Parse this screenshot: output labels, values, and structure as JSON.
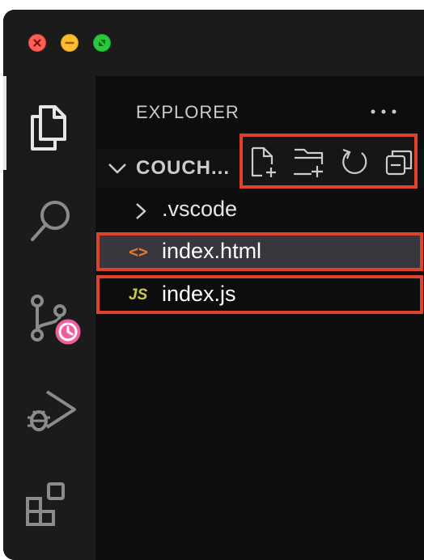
{
  "activity_bar": {
    "items": [
      {
        "name": "explorer",
        "icon": "files-icon",
        "active": true
      },
      {
        "name": "search",
        "icon": "search-icon"
      },
      {
        "name": "source-control",
        "icon": "source-control-icon",
        "badge_icon": "clock-icon",
        "badge_color": "#f25d9c"
      },
      {
        "name": "run-and-debug",
        "icon": "run-debug-icon"
      },
      {
        "name": "extensions",
        "icon": "extensions-icon"
      }
    ]
  },
  "sidebar": {
    "title": "EXPLORER",
    "more_icon": "ellipsis-icon",
    "section": {
      "title": "COUCH...",
      "actions": [
        {
          "name": "new-file",
          "icon": "new-file-icon"
        },
        {
          "name": "new-folder",
          "icon": "new-folder-icon"
        },
        {
          "name": "refresh",
          "icon": "refresh-icon"
        },
        {
          "name": "collapse-all",
          "icon": "collapse-all-icon"
        }
      ]
    },
    "tree": [
      {
        "type": "folder",
        "label": ".vscode"
      },
      {
        "type": "file",
        "label": "index.html",
        "icon_text": "<>",
        "selected": true
      },
      {
        "type": "file",
        "label": "index.js",
        "icon_text": "JS"
      }
    ]
  },
  "colors": {
    "highlight": "#e0412b",
    "html_icon": "#e37933",
    "js_icon": "#cbcb41"
  }
}
